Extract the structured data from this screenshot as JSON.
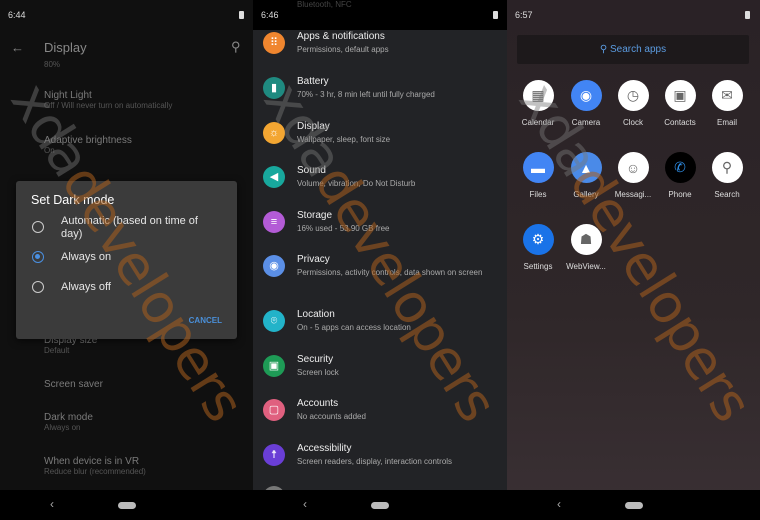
{
  "watermark": {
    "a": "xda",
    "b": "developers"
  },
  "display_screen": {
    "time": "6:44",
    "title": "Display",
    "partial_top": "80%",
    "items": [
      {
        "title": "Night Light",
        "sub": "Off / Will never turn on automatically"
      },
      {
        "title": "Adaptive brightness",
        "sub": "On"
      },
      {
        "title": "Display size",
        "sub": "Default"
      },
      {
        "title": "Screen saver",
        "sub": ""
      },
      {
        "title": "Dark mode",
        "sub": "Always on"
      },
      {
        "title": "When device is in VR",
        "sub": "Reduce blur (recommended)"
      }
    ],
    "dialog": {
      "title": "Set Dark mode",
      "options": [
        "Automatic (based on time of day)",
        "Always on",
        "Always off"
      ],
      "selected": "Always on",
      "cancel": "CANCEL"
    }
  },
  "settings_screen": {
    "time": "6:46",
    "partial_top": "Bluetooth, NFC",
    "items": [
      {
        "title": "Apps & notifications",
        "sub": "Permissions, default apps",
        "icon": "apps-grid-icon",
        "color": "#f0862f"
      },
      {
        "title": "Battery",
        "sub": "70% - 3 hr, 8 min left until fully charged",
        "icon": "battery-icon",
        "color": "#1f8a80"
      },
      {
        "title": "Display",
        "sub": "Wallpaper, sleep, font size",
        "icon": "brightness-icon",
        "color": "#f3a632"
      },
      {
        "title": "Sound",
        "sub": "Volume, vibration, Do Not Disturb",
        "icon": "volume-icon",
        "color": "#18a89d"
      },
      {
        "title": "Storage",
        "sub": "16% used - 53.90 GB free",
        "icon": "storage-icon",
        "color": "#b35bd6"
      },
      {
        "title": "Privacy",
        "sub": "Permissions, activity controls, data shown on screen",
        "icon": "privacy-eye-icon",
        "color": "#5b8fe6"
      },
      {
        "title": "Location",
        "sub": "On - 5 apps can access location",
        "icon": "location-pin-icon",
        "color": "#22b3c9"
      },
      {
        "title": "Security",
        "sub": "Screen lock",
        "icon": "lock-icon",
        "color": "#1e9b56"
      },
      {
        "title": "Accounts",
        "sub": "No accounts added",
        "icon": "account-icon",
        "color": "#e0607f"
      },
      {
        "title": "Accessibility",
        "sub": "Screen readers, display, interaction controls",
        "icon": "accessibility-icon",
        "color": "#6a3ed6"
      }
    ]
  },
  "launcher_screen": {
    "time": "6:57",
    "search_placeholder": "Search apps",
    "apps": [
      {
        "label": "Calendar",
        "icon": "calendar-icon",
        "color": "#ffffff",
        "glyph": "▦"
      },
      {
        "label": "Camera",
        "icon": "camera-icon",
        "color": "#4285f4",
        "glyph": "◉"
      },
      {
        "label": "Clock",
        "icon": "clock-icon",
        "color": "#ffffff",
        "glyph": "◷"
      },
      {
        "label": "Contacts",
        "icon": "contacts-icon",
        "color": "#ffffff",
        "glyph": "▣"
      },
      {
        "label": "Email",
        "icon": "email-icon",
        "color": "#ffffff",
        "glyph": "✉"
      },
      {
        "label": "Files",
        "icon": "folder-icon",
        "color": "#4285f4",
        "glyph": "▬"
      },
      {
        "label": "Gallery",
        "icon": "gallery-icon",
        "color": "#4a8ae8",
        "glyph": "▲"
      },
      {
        "label": "Messagi...",
        "icon": "messaging-icon",
        "color": "#ffffff",
        "glyph": "☺"
      },
      {
        "label": "Phone",
        "icon": "phone-icon",
        "color": "#000000",
        "glyph": "✆"
      },
      {
        "label": "Search",
        "icon": "search-magnifier-icon",
        "color": "#ffffff",
        "glyph": "⚲"
      },
      {
        "label": "Settings",
        "icon": "settings-gear-icon",
        "color": "#1a73e8",
        "glyph": "⚙"
      },
      {
        "label": "WebView...",
        "icon": "android-webview-icon",
        "color": "#ffffff",
        "glyph": "☗"
      }
    ]
  }
}
